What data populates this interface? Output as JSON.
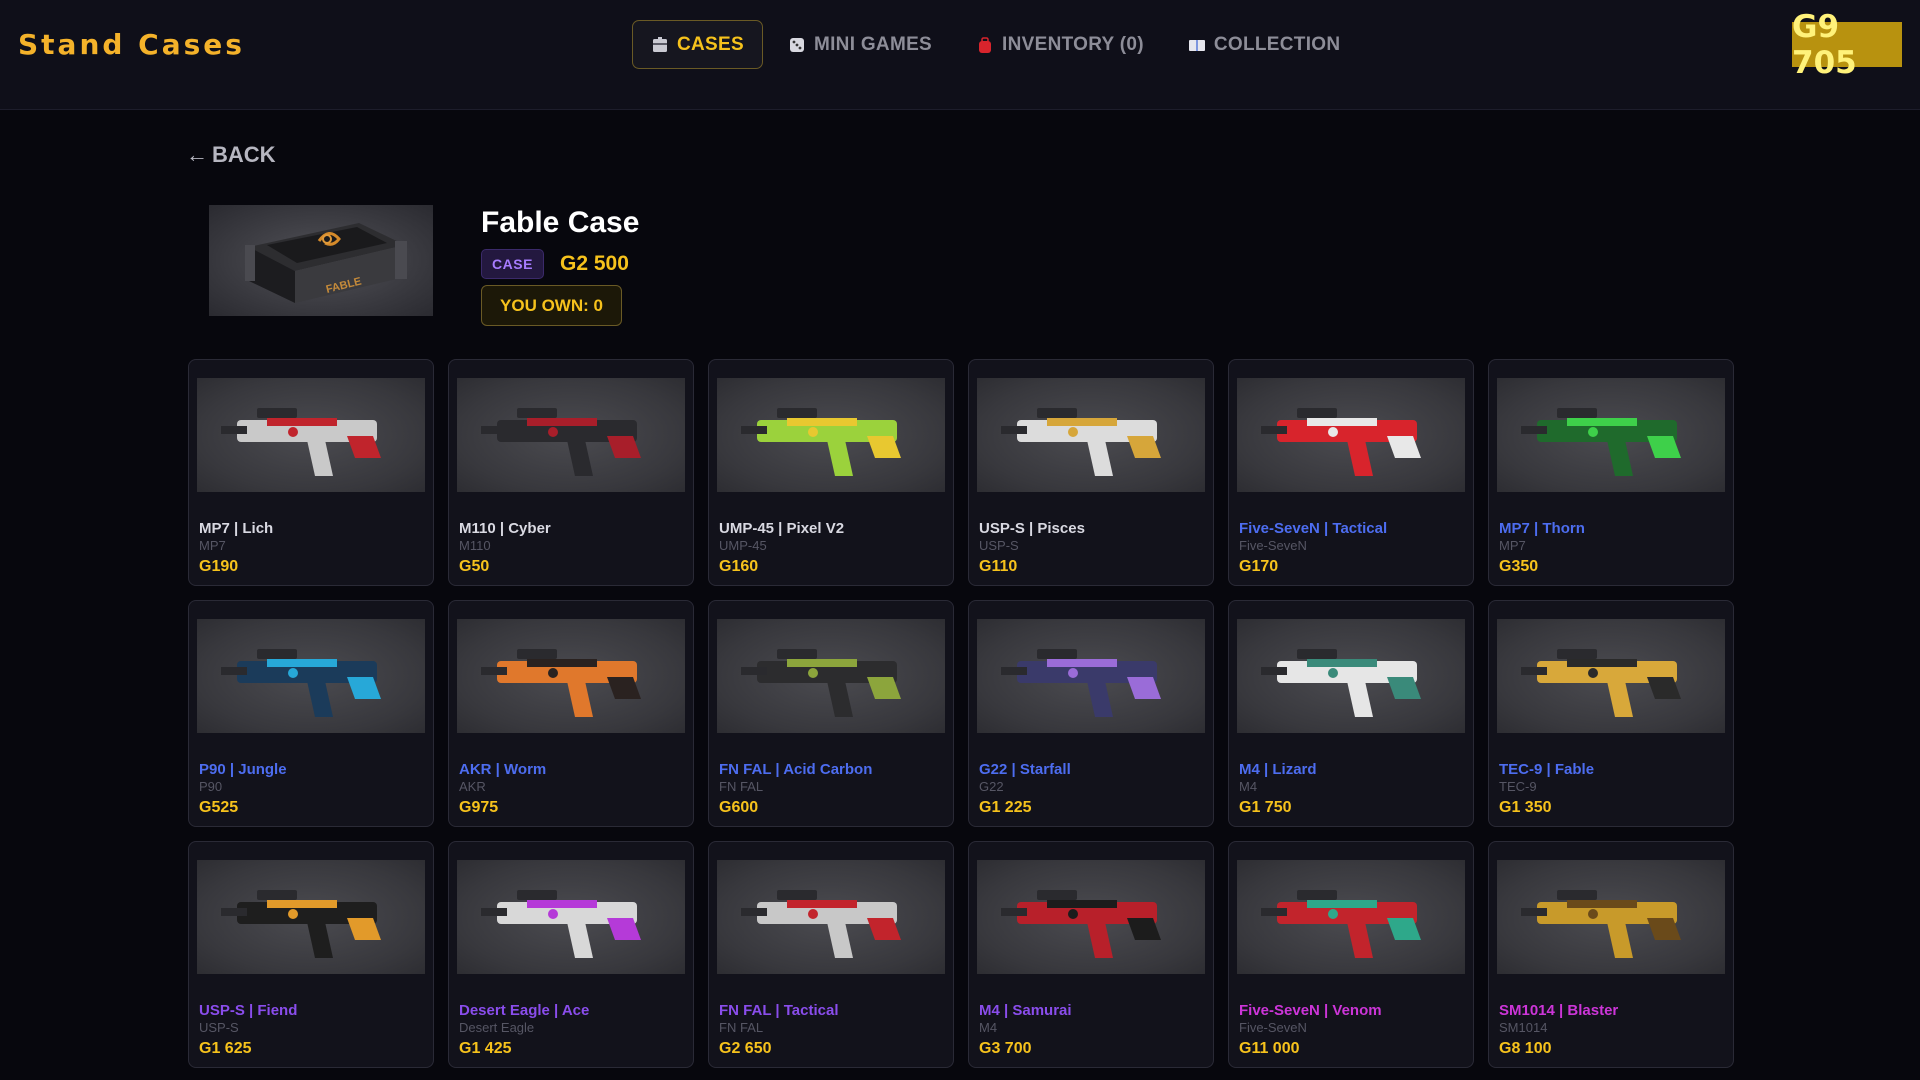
{
  "app": {
    "logo": "Stand Cases",
    "balance": "G9 705"
  },
  "nav": [
    {
      "label": "CASES",
      "icon": "case-icon",
      "active": true
    },
    {
      "label": "MINI GAMES",
      "icon": "dice-icon",
      "active": false
    },
    {
      "label": "INVENTORY (0)",
      "icon": "backpack-icon",
      "active": false
    },
    {
      "label": "COLLECTION",
      "icon": "book-icon",
      "active": false
    }
  ],
  "back": {
    "arrow": "←",
    "label": "BACK"
  },
  "case": {
    "title": "Fable Case",
    "badge": "CASE",
    "price": "G2 500",
    "owned": "YOU OWN: 0",
    "image_text": "FABLE"
  },
  "rarity_colors": {
    "white": "#d9d9e2",
    "blue": "#4d6df0",
    "purple": "#8a4dec",
    "pink": "#cc35d8"
  },
  "items": [
    {
      "name": "MP7 | Lich",
      "type": "MP7",
      "price": "G190",
      "rarity": "white",
      "colors": [
        "#c9c9c9",
        "#c0242c"
      ]
    },
    {
      "name": "M110 | Cyber",
      "type": "M110",
      "price": "G50",
      "rarity": "white",
      "colors": [
        "#2a2a2e",
        "#a81e2a"
      ]
    },
    {
      "name": "UMP-45 | Pixel V2",
      "type": "UMP-45",
      "price": "G160",
      "rarity": "white",
      "colors": [
        "#9bd23c",
        "#e8c830"
      ]
    },
    {
      "name": "USP-S | Pisces",
      "type": "USP-S",
      "price": "G110",
      "rarity": "white",
      "colors": [
        "#dcdcdc",
        "#d6a63a"
      ]
    },
    {
      "name": "Five-SeveN | Tactical",
      "type": "Five-SeveN",
      "price": "G170",
      "rarity": "blue",
      "colors": [
        "#d8242c",
        "#e8e8e8"
      ]
    },
    {
      "name": "MP7 | Thorn",
      "type": "MP7",
      "price": "G350",
      "rarity": "blue",
      "colors": [
        "#1f6a2c",
        "#3ed04a"
      ]
    },
    {
      "name": "P90 | Jungle",
      "type": "P90",
      "price": "G525",
      "rarity": "blue",
      "colors": [
        "#1b3b5a",
        "#27a8d8"
      ]
    },
    {
      "name": "AKR | Worm",
      "type": "AKR",
      "price": "G975",
      "rarity": "blue",
      "colors": [
        "#e0782c",
        "#2a2220"
      ]
    },
    {
      "name": "FN FAL | Acid Carbon",
      "type": "FN FAL",
      "price": "G600",
      "rarity": "blue",
      "colors": [
        "#2c2c2e",
        "#8ca53c"
      ]
    },
    {
      "name": "G22 | Starfall",
      "type": "G22",
      "price": "G1 225",
      "rarity": "blue",
      "colors": [
        "#3a3a6a",
        "#9a6cd8"
      ]
    },
    {
      "name": "M4 | Lizard",
      "type": "M4",
      "price": "G1 750",
      "rarity": "blue",
      "colors": [
        "#e6e6e6",
        "#3a8a7a"
      ]
    },
    {
      "name": "TEC-9 | Fable",
      "type": "TEC-9",
      "price": "G1 350",
      "rarity": "blue",
      "colors": [
        "#d8a83a",
        "#2a2a2a"
      ]
    },
    {
      "name": "USP-S | Fiend",
      "type": "USP-S",
      "price": "G1 625",
      "rarity": "purple",
      "colors": [
        "#1e1e1e",
        "#e29a2a"
      ]
    },
    {
      "name": "Desert Eagle | Ace",
      "type": "Desert Eagle",
      "price": "G1 425",
      "rarity": "purple",
      "colors": [
        "#d8d8d8",
        "#b53ad8"
      ]
    },
    {
      "name": "FN FAL | Tactical",
      "type": "FN FAL",
      "price": "G2 650",
      "rarity": "purple",
      "colors": [
        "#c8c8c8",
        "#c2242c"
      ]
    },
    {
      "name": "M4 | Samurai",
      "type": "M4",
      "price": "G3 700",
      "rarity": "purple",
      "colors": [
        "#b8202a",
        "#1c1c1c"
      ]
    },
    {
      "name": "Five-SeveN | Venom",
      "type": "Five-SeveN",
      "price": "G11 000",
      "rarity": "pink",
      "colors": [
        "#c2242c",
        "#2ea88a"
      ]
    },
    {
      "name": "SM1014 | Blaster",
      "type": "SM1014",
      "price": "G8 100",
      "rarity": "pink",
      "colors": [
        "#c89a2a",
        "#6a4a1a"
      ]
    }
  ]
}
